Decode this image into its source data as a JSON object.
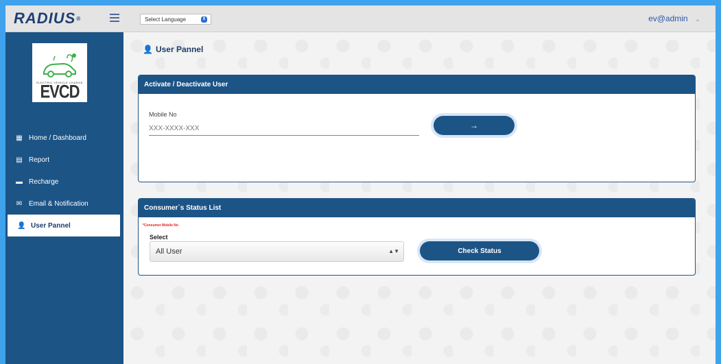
{
  "header": {
    "logo_text": "RADIUS",
    "logo_reg": "®",
    "language_select": "Select Language",
    "user": "ev@admin"
  },
  "sidebar": {
    "logo_brand": "EVCD",
    "logo_tagline": "ELECTRIC VEHICLE CHARGE",
    "items": [
      {
        "label": "Home / Dashboard",
        "icon": "dashboard-icon"
      },
      {
        "label": "Report",
        "icon": "report-icon"
      },
      {
        "label": "Recharge",
        "icon": "card-icon"
      },
      {
        "label": "Email & Notification",
        "icon": "envelope-icon"
      },
      {
        "label": "User Pannel",
        "icon": "user-icon",
        "active": true
      }
    ]
  },
  "main": {
    "page_title": "User Pannel",
    "activate_card": {
      "title": "Activate / Deactivate User",
      "mobile_label": "Mobile No",
      "mobile_placeholder": "XXX-XXXX-XXX",
      "submit_icon": "→"
    },
    "status_card": {
      "title": "Consumer`s Status List",
      "required_note": "*Consumer Mobile No",
      "select_label": "Select",
      "select_value": "All User",
      "check_button": "Check Status"
    }
  },
  "colors": {
    "primary": "#1d5486",
    "page_bg": "#3fa2ec",
    "required": "#e02020"
  }
}
